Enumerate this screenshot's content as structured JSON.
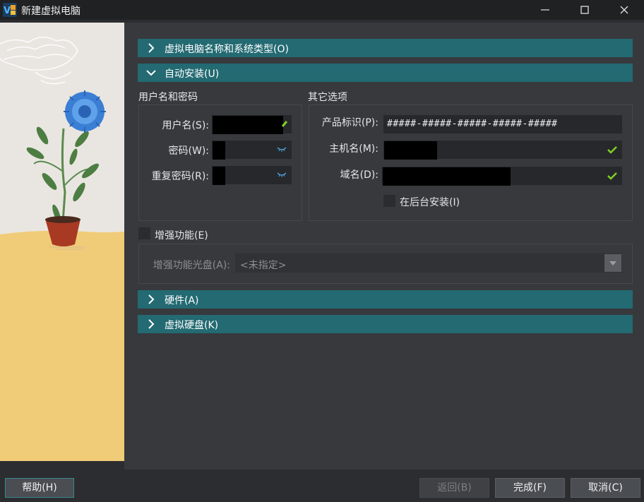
{
  "window": {
    "title": "新建虚拟电脑",
    "icon": "virtualbox-icon",
    "controls": [
      "minimize-icon",
      "maximize-icon",
      "close-icon"
    ]
  },
  "sections": {
    "name_os": "虚拟电脑名称和系统类型(O)",
    "unattended": "自动安装(U)",
    "hardware": "硬件(A)",
    "disk": "虚拟硬盘(K)"
  },
  "user_group": {
    "title": "用户名和密码",
    "username_label": "用户名(S):",
    "password_label": "密码(W):",
    "repeat_label": "重复密码(R):"
  },
  "other_group": {
    "title": "其它选项",
    "product_key_label": "产品标识(P):",
    "product_key_value": "#####-#####-#####-#####-#####",
    "hostname_label": "主机名(M):",
    "domain_label": "域名(D):",
    "background_install_label": "在后台安装(I)"
  },
  "guest_additions": {
    "checkbox_label": "增强功能(E)",
    "iso_label": "增强功能光盘(A):",
    "iso_value": "<未指定>"
  },
  "footer": {
    "help": "帮助(H)",
    "back": "返回(B)",
    "finish": "完成(F)",
    "cancel": "取消(C)"
  },
  "colors": {
    "section_bar": "#236a72",
    "check_ok": "#7ed321",
    "side_panel_bottom": "#f0cc78"
  }
}
